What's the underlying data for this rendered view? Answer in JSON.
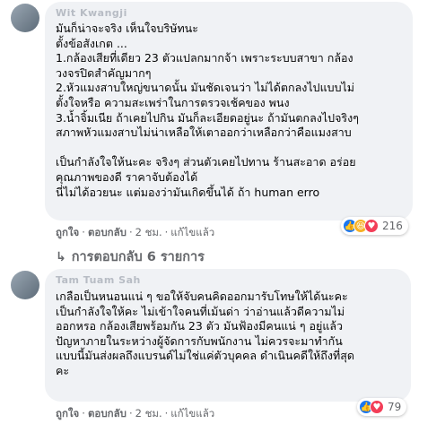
{
  "comment1": {
    "author": "Wit Kwangji",
    "text": "มันก็น่าจะจริง เห็นใจบริษัทนะ\nตั้งข้อสังเกต ...\n1.กล้องเสียที่เดียว 23 ตัวแปลกมากจ้า เพราะระบบสาขา กล้อง\nวงจรปิดสำคัญมากๆ\n2.หัวแมงสาบใหญ่ขนาดนั้น มันชัดเจนว่า ไม่ได้ตกลงไปแบบไม่\nตั้งใจหรือ ความสะเพร่าในการตรวจเช้คของ พนง\n3.น้ำจิ้มเนีย ถ้าเคยไปกิน มันก็ละเอียดอยู่นะ ถ้ามันตกลงไปจริงๆ\nสภาพหัวแมงสาบไม่น่าเหลือให้เตาออกว่าเหลือกว่าคือแมงสาบ\n\nเป็นกำลังใจให้นะคะ จริงๆ ส่วนตัวเคยไปทาน ร้านสะอาด อร่อย\nคุณภาพของดี ราคาจับต้องได้\nนี่ไม่ได้อวยนะ แต่มองว่ามันเกิดขึ้นได้ ถ้า human erro",
    "like_label": "ถูกใจ",
    "reply_label": "ตอบกลับ",
    "time": "2 ชม.",
    "edited": "แก้ไขแล้ว",
    "reaction_count": "216"
  },
  "replies_toggle": {
    "label": "การตอบกลับ 6 รายการ",
    "arrow": "↳"
  },
  "comment2": {
    "author": "Tam Tuam Sah",
    "text": "เกลือเป็นหนอนแน่ ๆ ขอให้จับคนคิดออกมารับโทษให้ได้นะคะ\nเป็นกำลังใจให้คะ ไม่เข้าใจคนที่เม้นด่า ว่าอ่านแล้วดีความไม่\nออกหรอ กล้องเสียพร้อมกัน 23 ตัว มันฟ้องมีคนแน่ ๆ อยู่แล้ว\nปัญหาภายในระหว่างผู้จัดการกับพนักงาน ไม่ควรจะมาทำกัน\nแบบนี้มันส่งผลถึงแบรนด์ไม่ใช่แค่ตัวบุคคล ดำเนินคดีให้ถึงที่สุด\nคะ",
    "like_label": "ถูกใจ",
    "reply_label": "ตอบกลับ",
    "time": "2 ชม.",
    "edited": "แก้ไขแล้ว",
    "reaction_count": "79"
  },
  "colors": {
    "bubble": "#f0f2f5",
    "like": "#1877f2",
    "love": "#f33e58",
    "haha": "#f7b125",
    "meta": "#65676b"
  }
}
